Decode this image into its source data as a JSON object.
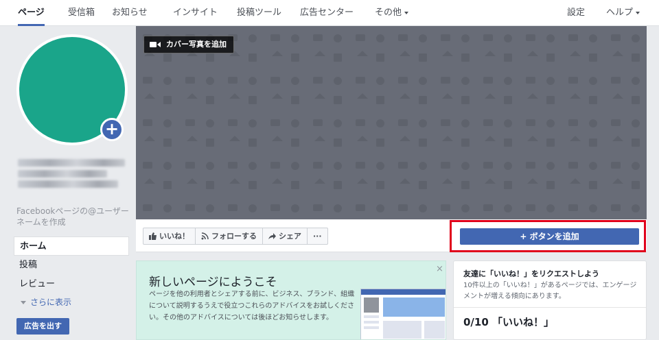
{
  "topnav": {
    "items": [
      {
        "label": "ページ"
      },
      {
        "label": "受信箱"
      },
      {
        "label": "お知らせ"
      },
      {
        "label": "インサイト"
      },
      {
        "label": "投稿ツール"
      },
      {
        "label": "広告センター"
      },
      {
        "label": "その他"
      }
    ],
    "settings": "設定",
    "help": "ヘルプ"
  },
  "sidebar": {
    "username_link": "Facebookページの@ユーザーネームを作成",
    "menu": [
      {
        "label": "ホーム"
      },
      {
        "label": "投稿"
      },
      {
        "label": "レビュー"
      }
    ],
    "see_more": "さらに表示",
    "promote": "広告を出す"
  },
  "cover": {
    "add_cover": "カバー写真を追加"
  },
  "actions": {
    "like": "いいね！",
    "follow": "フォローする",
    "share": "シェア",
    "more": "···",
    "add_button": "+ ボタンを追加"
  },
  "welcome": {
    "title": "新しいページにようこそ",
    "text": "ページを他の利用者とシェアする前に、ビジネス、ブランド、組織について説明するうえで役立つこれらのアドバイスをお試しください。その他のアドバイスについては後ほどお知らせします。",
    "close": "×"
  },
  "invite": {
    "title": "友達に「いいね！」をリクエストしよう",
    "text": "10件以上の「いいね！」があるページでは、エンゲージメントが増える傾向にあります。",
    "count": "0/10 「いいね！」"
  },
  "colors": {
    "accent": "#4267b2",
    "profile": "#1aa58a",
    "cover": "#686c77",
    "welcome_bg": "#d4f1e8",
    "highlight": "#e0001b"
  }
}
